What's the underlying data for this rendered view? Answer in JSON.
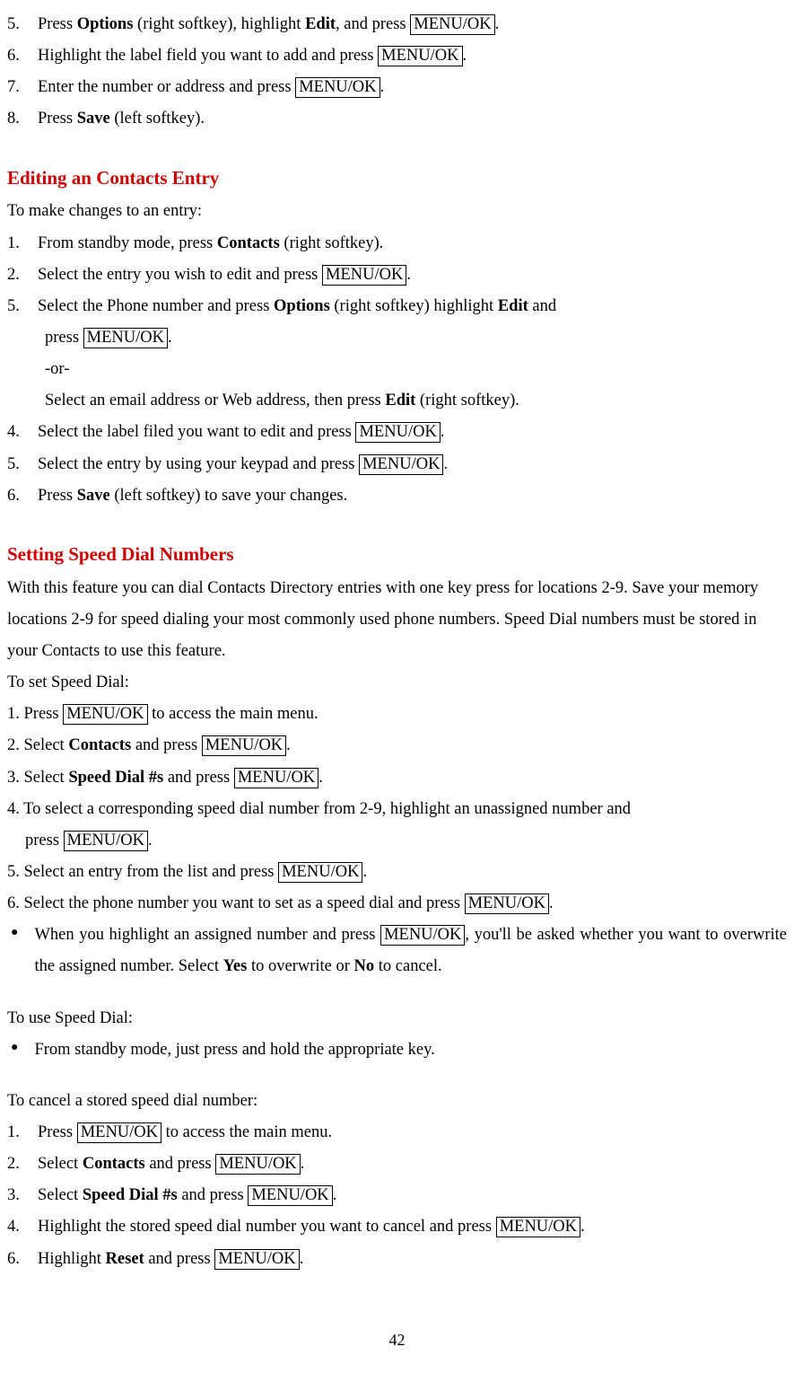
{
  "topSteps": {
    "s5": {
      "n": "5.",
      "a": "Press ",
      "b": "Options",
      "c": " (right softkey), highlight ",
      "d": "Edit",
      "e": ", and press ",
      "f": "MENU/OK",
      "g": "."
    },
    "s6": {
      "n": "6.",
      "a": "Highlight the label field you want to add and press ",
      "b": "MENU/OK",
      "c": "."
    },
    "s7": {
      "n": "7.",
      "a": "Enter the number or address and press ",
      "b": "MENU/OK",
      "c": "."
    },
    "s8": {
      "n": "8.",
      "a": "Press ",
      "b": "Save",
      "c": " (left softkey)."
    }
  },
  "h1": "Editing an Contacts Entry",
  "p1": "To make changes to an entry:",
  "edit": {
    "s1": {
      "n": "1.",
      "a": "From standby mode, press ",
      "b": "Contacts",
      "c": " (right softkey)."
    },
    "s2": {
      "n": "2.",
      "a": "Select the entry you wish to edit and press ",
      "b": "MENU/OK",
      "c": "."
    },
    "s3": {
      "n": "5.",
      "a": "Select the Phone number and press ",
      "b": "Options",
      "c": " (right softkey) highlight ",
      "d": "Edit",
      "e": " and"
    },
    "s3b": {
      "a": "press ",
      "b": "MENU/OK",
      "c": "."
    },
    "s3c": "-or-",
    "s3d": {
      "a": "Select an email address or Web address, then press ",
      "b": "Edit",
      "c": " (right softkey)."
    },
    "s4": {
      "n": "4.",
      "a": "Select the label filed you want to edit and press ",
      "b": "MENU/OK",
      "c": "."
    },
    "s5": {
      "n": "5.",
      "a": "Select the entry by using your keypad and press ",
      "b": "MENU/OK",
      "c": "."
    },
    "s6": {
      "n": "6.",
      "a": "Press ",
      "b": "Save",
      "c": " (left softkey) to save your changes."
    }
  },
  "h2": "Setting Speed Dial Numbers",
  "sp1": "With this feature you can dial Contacts Directory entries with one key press for locations 2-9. Save your memory locations 2-9 for speed dialing your most commonly used phone numbers. Speed Dial numbers must be stored in your Contacts to use this feature.",
  "sp2": "To set Speed Dial:",
  "set": {
    "s1": {
      "a": "1. Press ",
      "b": "MENU/OK",
      "c": " to access the main menu."
    },
    "s2": {
      "a": "2. Select ",
      "b": "Contacts",
      "c": " and press ",
      "d": "MENU/OK",
      "e": "."
    },
    "s3": {
      "a": "3. Select ",
      "b": "Speed Dial #s",
      "c": " and press ",
      "d": "MENU/OK",
      "e": "."
    },
    "s4a": "4. To select a corresponding speed dial number from 2-9, highlight an unassigned number and",
    "s4b": {
      "a": "press ",
      "b": "MENU/OK",
      "c": "."
    },
    "s5": {
      "a": "5. Select an entry from the list and press ",
      "b": "MENU/OK",
      "c": "."
    },
    "s6": {
      "a": "6. Select the phone number you want to set as a speed dial and press ",
      "b": "MENU/OK",
      "c": "."
    },
    "bul": {
      "a": "When you highlight an assigned number and press ",
      "b": "MENU/OK",
      "c": ", you'll be asked whether you want to overwrite the assigned number. Select ",
      "d": "Yes",
      "e": " to overwrite or ",
      "f": "No",
      "g": " to cancel."
    }
  },
  "use1": "To use Speed Dial:",
  "use2": "From standby mode, just press and hold the appropriate key.",
  "cancel1": "To cancel a stored speed dial number:",
  "cancel": {
    "s1": {
      "n": "1.",
      "a": "Press ",
      "b": "MENU/OK",
      "c": " to access the main menu."
    },
    "s2": {
      "n": "2.",
      "a": "Select ",
      "b": "Contacts",
      "c": " and press ",
      "d": "MENU/OK",
      "e": "."
    },
    "s3": {
      "n": "3.",
      "a": "Select ",
      "b": "Speed Dial #s",
      "c": " and press ",
      "d": "MENU/OK",
      "e": "."
    },
    "s4": {
      "n": "4.",
      "a": "Highlight the stored speed dial number you want to cancel and press ",
      "b": "MENU/OK",
      "c": "."
    },
    "s6": {
      "n": "6.",
      "a": "Highlight ",
      "b": "Reset",
      "c": " and press ",
      "d": "MENU/OK",
      "e": "."
    }
  },
  "page": "42"
}
